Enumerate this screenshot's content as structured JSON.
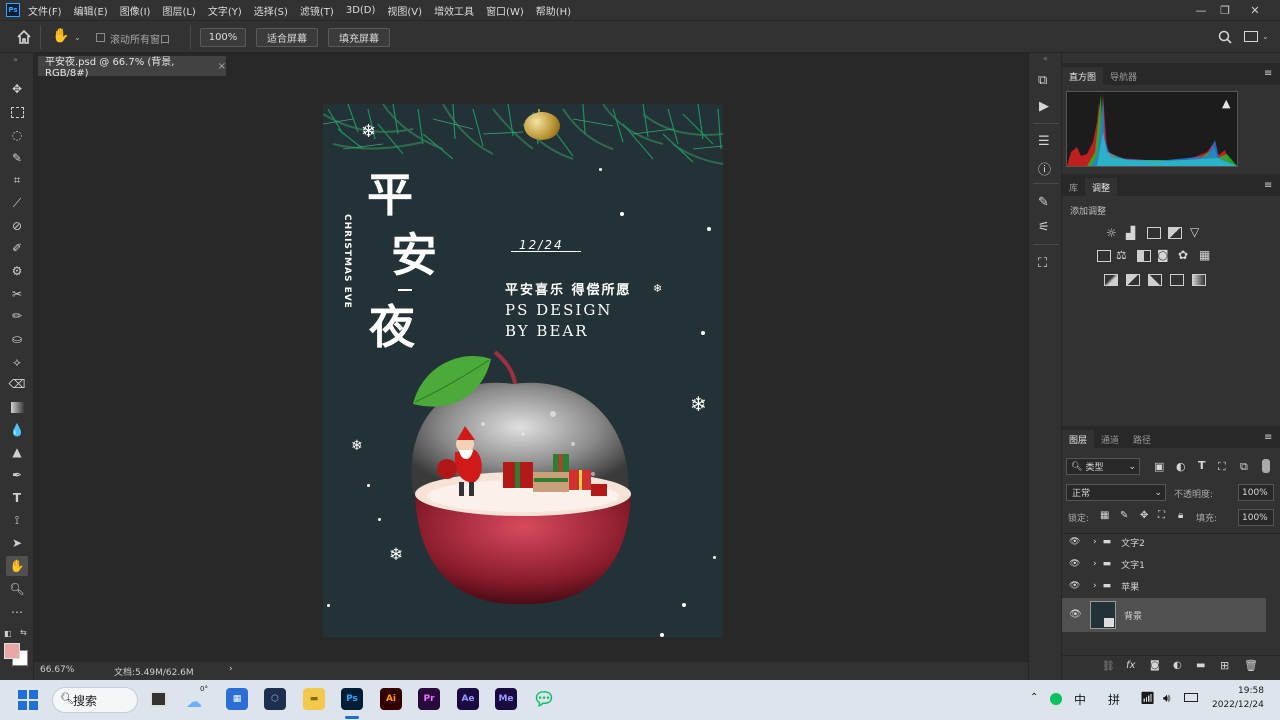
{
  "app": {
    "logo": "Ps",
    "menu": [
      "文件(F)",
      "编辑(E)",
      "图像(I)",
      "图层(L)",
      "文字(Y)",
      "选择(S)",
      "滤镜(T)",
      "3D(D)",
      "视图(V)",
      "增效工具",
      "窗口(W)",
      "帮助(H)"
    ],
    "window_controls": [
      "minimize-icon",
      "restore-icon",
      "close-icon"
    ]
  },
  "options": {
    "scroll_all_label": "滚动所有窗口",
    "zoom_value": "100%",
    "fit_screen_label": "适合屏幕",
    "fill_screen_label": "填充屏幕"
  },
  "document": {
    "tab_title": "平安夜.psd @ 66.7% (背景, RGB/8#)",
    "zoom": "66.67%",
    "doc_size": "文档:5.49M/62.6M"
  },
  "poster": {
    "title_chars": [
      "平",
      "安",
      "夜"
    ],
    "vertical_text": "CHRISTMAS EVE",
    "date": "12/24",
    "slogan": "平安喜乐 得偿所愿",
    "line1": "PS DESIGN",
    "line2": "BY BEAR"
  },
  "panels": {
    "histogram_tabs": [
      "直方图",
      "导航器"
    ],
    "adjust_tabs": [
      "库",
      "调整"
    ],
    "adjust_heading": "添加调整",
    "layer_tabs": [
      "图层",
      "通道",
      "路径"
    ],
    "filter_kind": "类型",
    "blend_mode": "正常",
    "opacity_label": "不透明度:",
    "opacity_value": "100%",
    "lock_label": "锁定:",
    "fill_label": "填充:",
    "fill_value": "100%",
    "layers": [
      {
        "name": "文字2",
        "type": "group"
      },
      {
        "name": "文字1",
        "type": "group"
      },
      {
        "name": "苹果",
        "type": "group"
      },
      {
        "name": "背景",
        "type": "smart-object"
      }
    ]
  },
  "taskbar": {
    "search_label": "搜索",
    "weather": "0°",
    "apps": [
      {
        "label": "Ai",
        "color": "#330000",
        "text_color": "#ff9a00"
      },
      {
        "label": "Pr",
        "color": "#2a0a3d",
        "text_color": "#ea77ff"
      },
      {
        "label": "Ae",
        "color": "#1a0a40",
        "text_color": "#9999ff"
      },
      {
        "label": "Me",
        "color": "#1a0a40",
        "text_color": "#9999ff"
      }
    ],
    "ps_label": "Ps",
    "ime1": "中",
    "ime2": "拼",
    "time": "19:58",
    "date": "2022/12/24"
  }
}
